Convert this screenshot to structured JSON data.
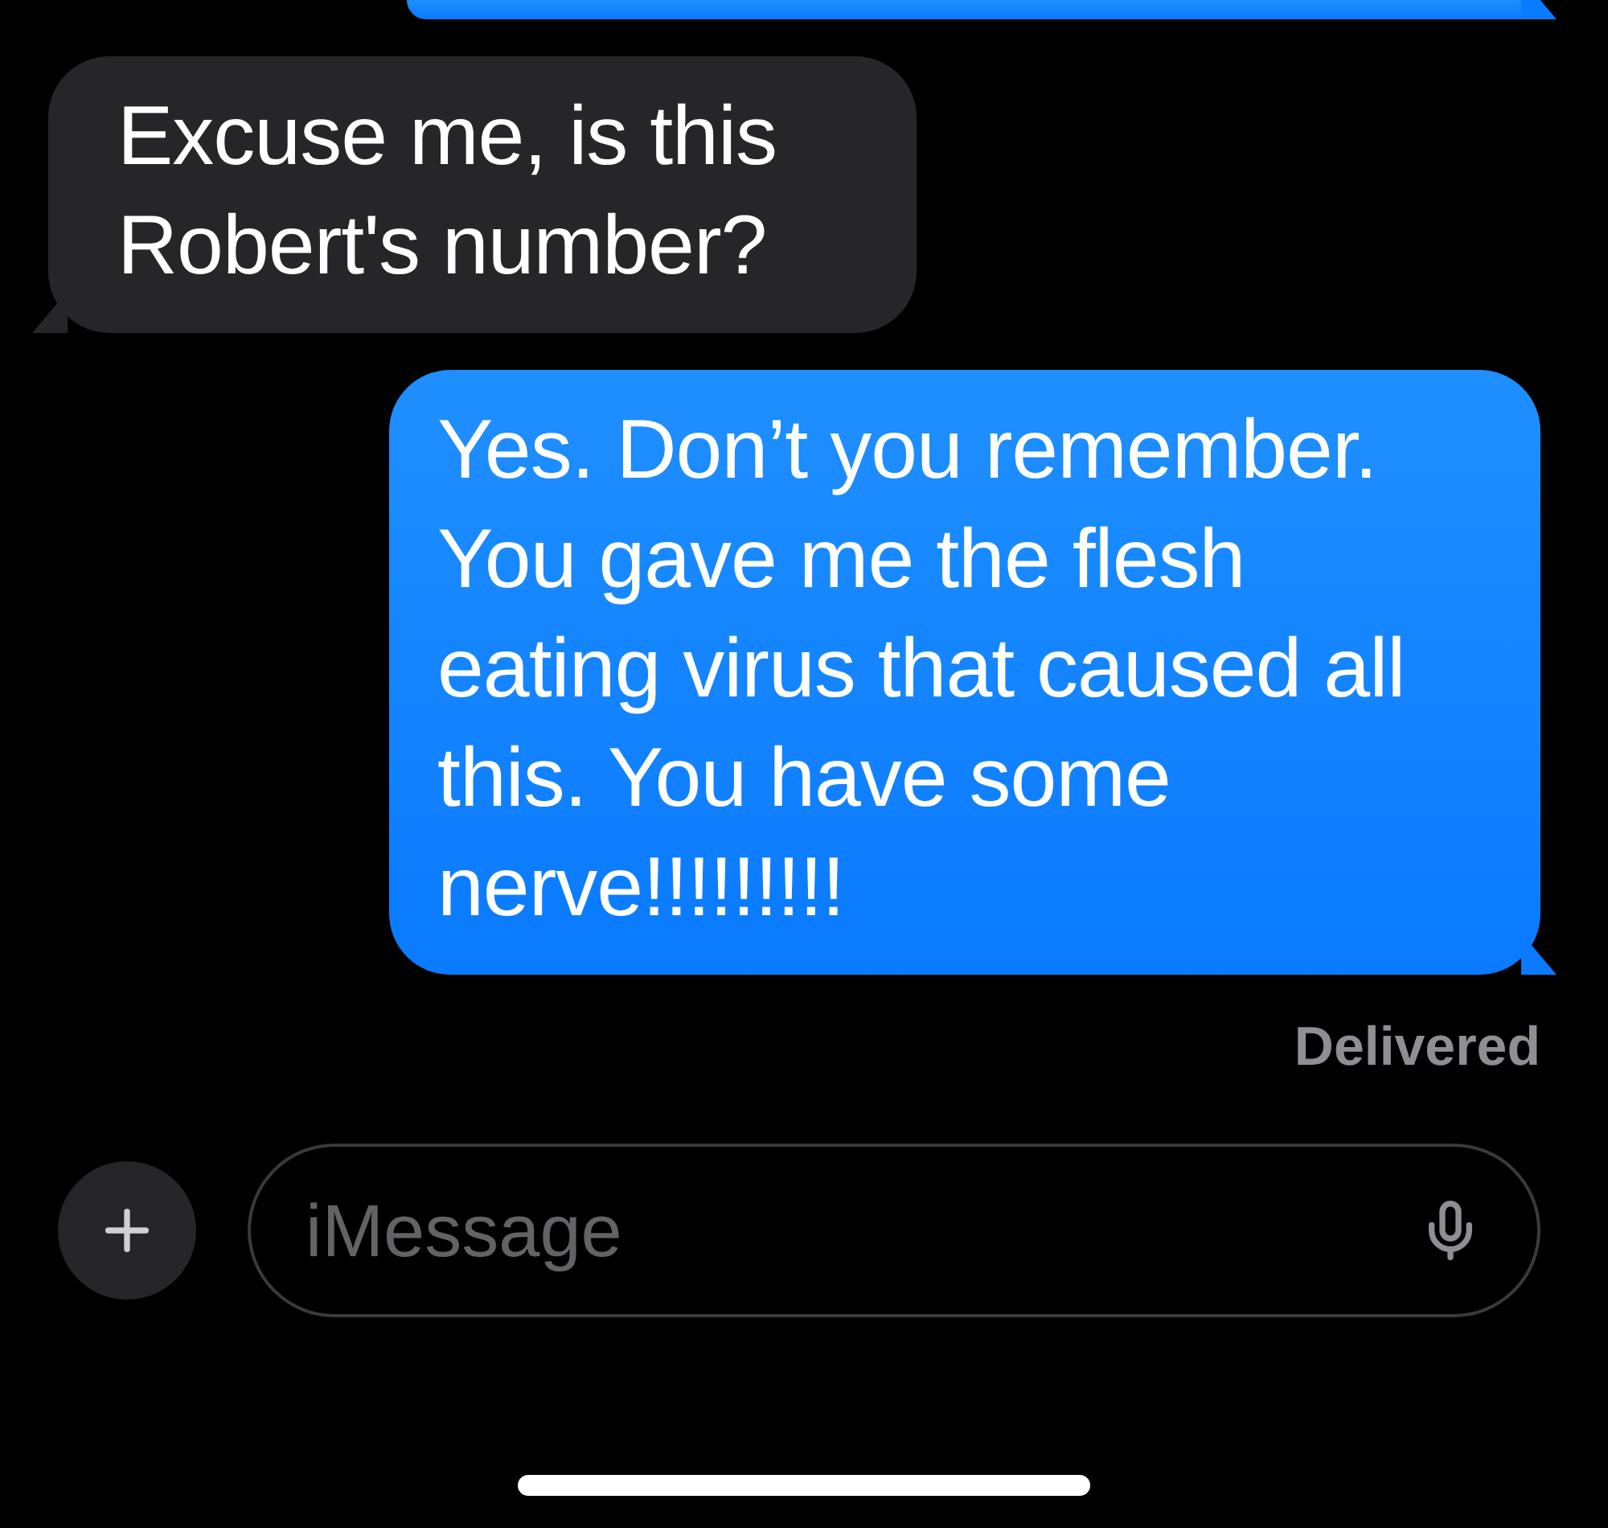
{
  "messages": [
    {
      "kind": "sent",
      "cut_off": true
    },
    {
      "kind": "received",
      "text": "Excuse me, is this Robert's number?"
    },
    {
      "kind": "sent",
      "text": "Yes. Don’t you remember. You gave me the flesh eating virus that caused all this. You have some nerve!!!!!!!!!"
    }
  ],
  "delivery_status": "Delivered",
  "composer": {
    "placeholder": "iMessage"
  }
}
